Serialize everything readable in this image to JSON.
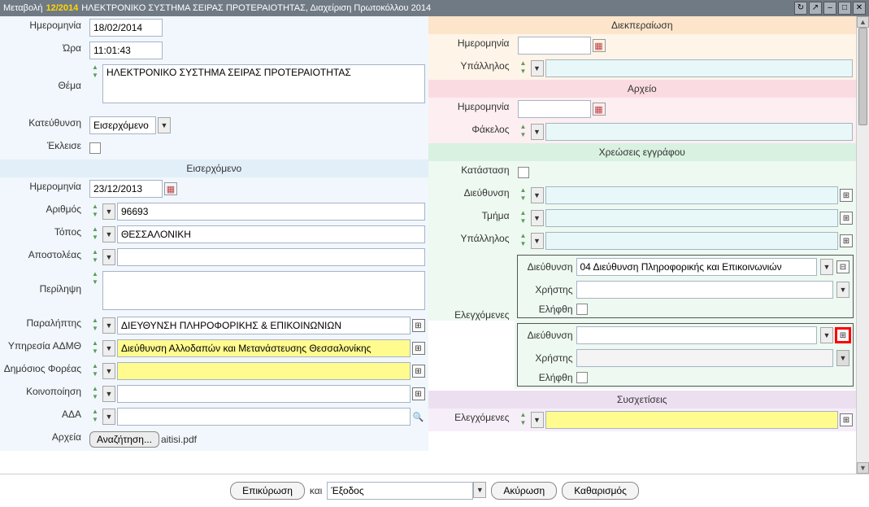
{
  "title": {
    "prefix": "Μεταβολή",
    "num": "12/2014",
    "rest": " ΗΛΕΚΤΡΟΝΙΚΟ ΣΥΣΤΗΜΑ ΣΕΙΡΑΣ ΠΡΟΤΕΡΑΙΟΤΗΤΑΣ, Διαχείριση Πρωτοκόλλου 2014"
  },
  "left": {
    "date_lbl": "Ημερομηνία",
    "date_val": "18/02/2014",
    "time_lbl": "Ώρα",
    "time_val": "11:01:43",
    "subject_lbl": "Θέμα",
    "subject_val": "ΗΛΕΚΤΡΟΝΙΚΟ ΣΥΣΤΗΜΑ ΣΕΙΡΑΣ ΠΡΟΤΕΡΑΙΟΤΗΤΑΣ",
    "direction_lbl": "Κατεύθυνση",
    "direction_val": "Εισερχόμενο",
    "closed_lbl": "Έκλεισε",
    "incoming_hdr": "Εισερχόμενο",
    "in_date_lbl": "Ημερομηνία",
    "in_date_val": "23/12/2013",
    "number_lbl": "Αριθμός",
    "number_val": "96693",
    "place_lbl": "Τόπος",
    "place_val": "ΘΕΣΣΑΛΟΝΙΚΗ",
    "sender_lbl": "Αποστολέας",
    "sender_val": "",
    "summary_lbl": "Περίληψη",
    "summary_val": "",
    "recipient_lbl": "Παραλήπτης",
    "recipient_val": "ΔΙΕΥΘΥΝΣΗ ΠΛΗΡΟΦΟΡΙΚΗΣ & ΕΠΙΚΟΙΝΩΝΙΩΝ",
    "admth_lbl": "Υπηρεσία ΑΔΜΘ",
    "admth_val": "Διεύθυνση Αλλοδαπών και Μετανάστευσης Θεσσαλονίκης",
    "public_lbl": "Δημόσιος Φορέας",
    "public_val": "",
    "notify_lbl": "Κοινοποίηση",
    "notify_val": "",
    "ada_lbl": "ΑΔΑ",
    "ada_val": "",
    "files_lbl": "Αρχεία",
    "files_btn": "Αναζήτηση...",
    "files_val": "aitisi.pdf"
  },
  "right": {
    "process_hdr": "Διεκπεραίωση",
    "p_date_lbl": "Ημερομηνία",
    "p_date_val": "",
    "p_emp_lbl": "Υπάλληλος",
    "p_emp_val": "",
    "archive_hdr": "Αρχείο",
    "a_date_lbl": "Ημερομηνία",
    "a_date_val": "",
    "a_folder_lbl": "Φάκελος",
    "a_folder_val": "",
    "charges_hdr": "Χρεώσεις εγγράφου",
    "c_status_lbl": "Κατάσταση",
    "c_dir_lbl": "Διεύθυνση",
    "c_dept_lbl": "Τμήμα",
    "c_emp_lbl": "Υπάλληλος",
    "checked_lbl": "Ελεγχόμενες",
    "nested1": {
      "dir_lbl": "Διεύθυνση",
      "dir_val": "04 Διεύθυνση Πληροφορικής και Επικοινωνιών",
      "user_lbl": "Χρήστης",
      "user_val": "",
      "received_lbl": "Ελήφθη"
    },
    "nested2": {
      "dir_lbl": "Διεύθυνση",
      "dir_val": "",
      "user_lbl": "Χρήστης",
      "user_val": "",
      "received_lbl": "Ελήφθη"
    },
    "assoc_hdr": "Συσχετίσεις",
    "assoc_checked_lbl": "Ελεγχόμενες",
    "assoc_checked_val": ""
  },
  "footer": {
    "confirm": "Επικύρωση",
    "and": "και",
    "exit": "Έξοδος",
    "cancel": "Ακύρωση",
    "clear": "Καθαρισμός"
  }
}
